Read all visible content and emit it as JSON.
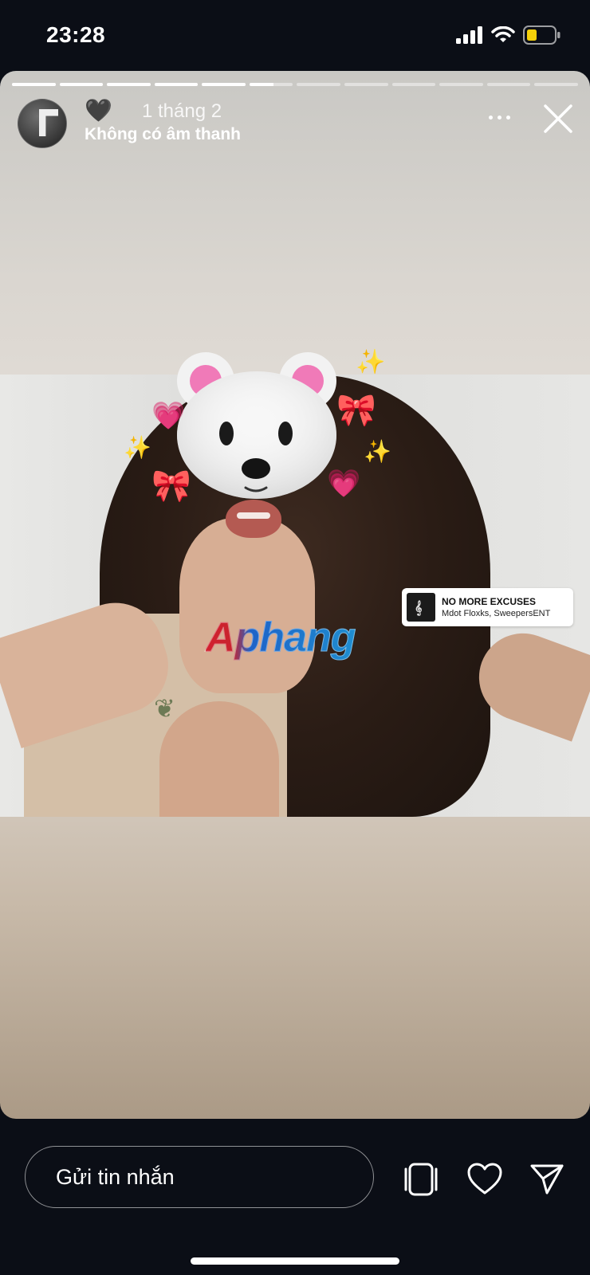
{
  "status_bar": {
    "time": "23:28",
    "icons": [
      "signal-icon",
      "wifi-icon",
      "battery-icon"
    ],
    "battery_color": "#f5d10a"
  },
  "story": {
    "progress": {
      "segments": 12,
      "completed": 5,
      "current_fill": 0.55
    },
    "header": {
      "badge_emoji": "🖤",
      "date": "1 tháng 2",
      "audio_status": "Không có âm thanh"
    },
    "music_sticker": {
      "title": "NO MORE EXCUSES",
      "artist": "Mdot Floxks, SweepersENT"
    },
    "watermark": "Aphang",
    "stickers": {
      "bear": "polar-bear-memoji",
      "hearts": "💗",
      "bows": "🎀",
      "sparkles": "✨"
    }
  },
  "bottom_bar": {
    "message_placeholder": "Gửi tin nhắn",
    "icons": [
      "sticker-icon",
      "heart-icon",
      "send-icon"
    ]
  },
  "colors": {
    "background": "#0b0e16",
    "accent_white": "#ffffff"
  }
}
